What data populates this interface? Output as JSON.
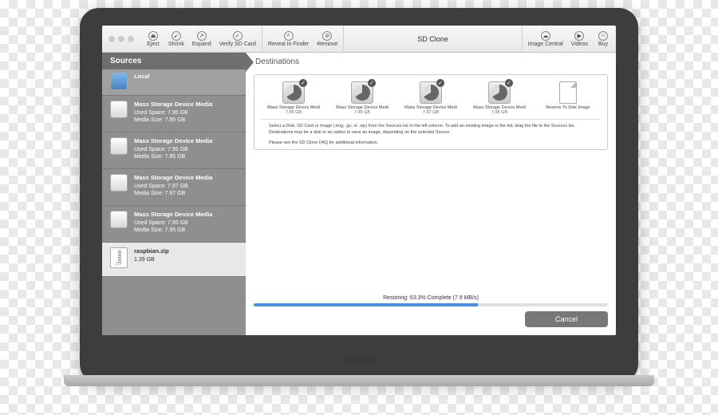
{
  "window": {
    "title": "SD Clone"
  },
  "toolbar": {
    "left": [
      {
        "label": "Eject",
        "icon": "eject-icon"
      },
      {
        "label": "Shrink",
        "icon": "shrink-icon"
      },
      {
        "label": "Expand",
        "icon": "expand-icon"
      },
      {
        "label": "Verify SD Card",
        "icon": "verify-icon"
      }
    ],
    "middle": [
      {
        "label": "Reveal In Finder",
        "icon": "magnify-icon"
      },
      {
        "label": "Remove",
        "icon": "remove-icon"
      }
    ],
    "right": [
      {
        "label": "Image Central",
        "icon": "globe-icon"
      },
      {
        "label": "Videos",
        "icon": "video-icon"
      },
      {
        "label": "Buy",
        "icon": "cart-icon"
      }
    ]
  },
  "sections": {
    "sources": "Sources",
    "destinations": "Destinations"
  },
  "sources": {
    "local": {
      "name": "Local"
    },
    "drives": [
      {
        "name": "Mass Storage Device Media",
        "used": "Used Space: 7.95 GB",
        "size": "Media Size: 7.95 GB"
      },
      {
        "name": "Mass Storage Device Media",
        "used": "Used Space: 7.95 GB",
        "size": "Media Size: 7.95 GB"
      },
      {
        "name": "Mass Storage Device Media",
        "used": "Used Space: 7.97 GB",
        "size": "Media Size: 7.97 GB"
      },
      {
        "name": "Mass Storage Device Media",
        "used": "Used Space: 7.95 GB",
        "size": "Media Size: 7.95 GB"
      }
    ],
    "zip": {
      "name": "raspbian.zip",
      "size": "1.39 GB",
      "ext": "ZIP"
    }
  },
  "destinations": {
    "items": [
      {
        "name": "Mass Storage Device Medi",
        "size": "7.95 GB",
        "checked": true
      },
      {
        "name": "Mass Storage Device Medi",
        "size": "7.95 GB",
        "checked": true
      },
      {
        "name": "Mass Storage Device Medi",
        "size": "7.97 GB",
        "checked": true
      },
      {
        "name": "Mass Storage Device Medi",
        "size": "7.95 GB",
        "checked": true
      }
    ],
    "restore": {
      "name": "Restore To Disk Image"
    }
  },
  "info": {
    "line1": "Select a Disk, SD Card or image (.img, .gz, or .zip) from the Sources list in the left column.  To add an existing image to the list, drag the file to the Sources list.  Destinations may be a disk or an option to save an image, depending on the selected Source.",
    "line2": "Please see the SD Clone FAQ for additional information."
  },
  "progress": {
    "label": "Restoring: 63.3% Complete (7.9 MB/s)",
    "percent": 63.3
  },
  "buttons": {
    "cancel": "Cancel"
  },
  "device": {
    "label": "MacBook"
  }
}
